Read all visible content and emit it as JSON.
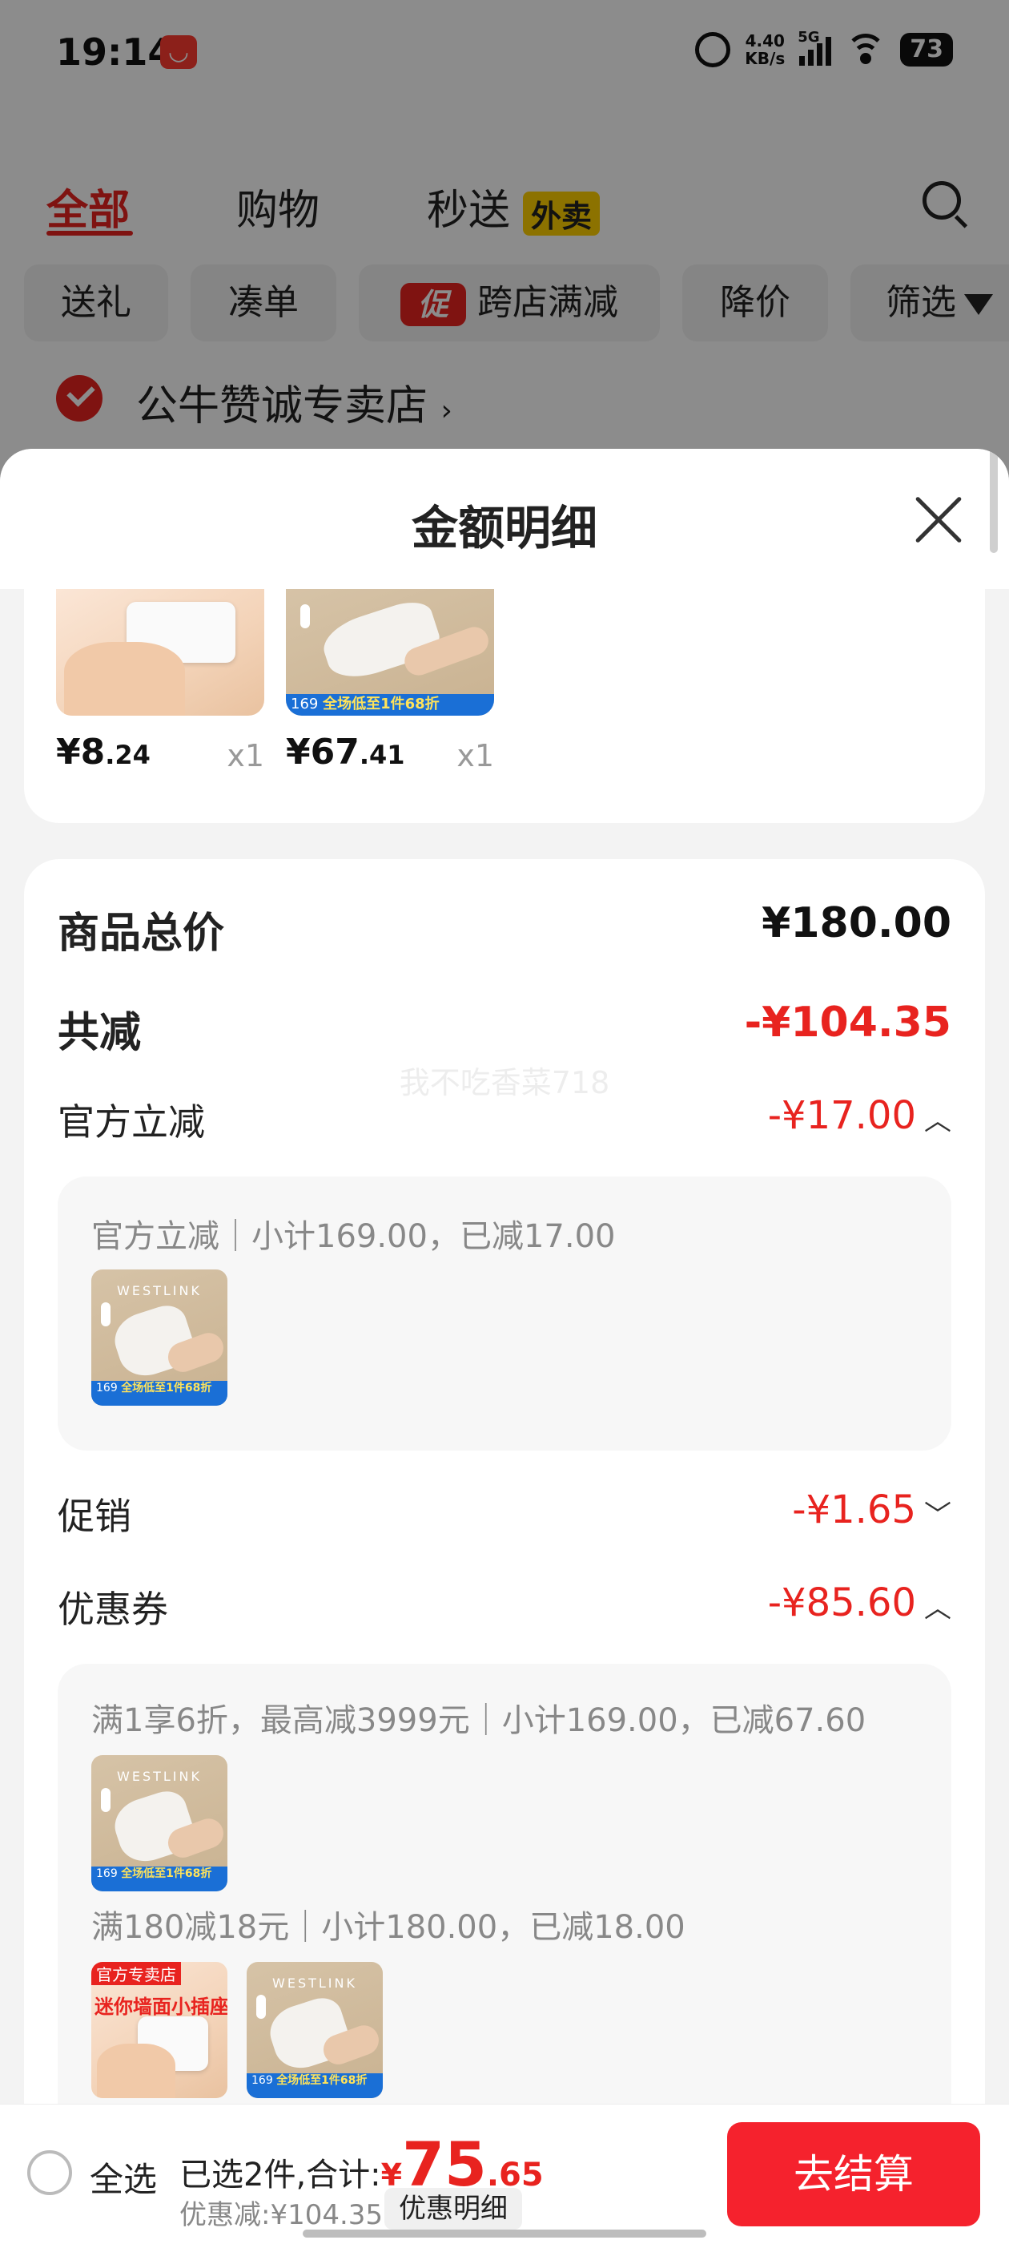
{
  "status_bar": {
    "time": "19:14",
    "app_badge_icon": "tmall-app-icon",
    "net_speed_value": "4.40",
    "net_speed_unit": "KB/s",
    "network_type": "5G",
    "battery": "73"
  },
  "background_page": {
    "tabs": {
      "all": "全部",
      "shopping": "购物",
      "instant": "秒送",
      "takeout_badge": "外卖"
    },
    "filters": {
      "gift": "送礼",
      "bundle": "凑单",
      "promo_tag": "促",
      "cross_store": "跨店满减",
      "price_drop": "降价",
      "filter": "筛选"
    },
    "store_name": "公牛赞诚专卖店"
  },
  "sheet": {
    "title": "金额明细",
    "products": [
      {
        "price_int": "¥8",
        "price_dec": ".24",
        "qty": "x1"
      },
      {
        "price_int": "¥67",
        "price_dec": ".41",
        "qty": "x1"
      }
    ],
    "thumb_text": {
      "brand": "WESTLINK",
      "banner_price": "169",
      "banner_text": "全场低至1件68折",
      "socket_tag": "官方专卖店",
      "socket_slogan": "迷你墙面小插座"
    },
    "summary": {
      "total_label": "商品总价",
      "total_value": "¥180.00",
      "reduce_label": "共减",
      "reduce_value": "-¥104.35",
      "official_label": "官方立减",
      "official_value": "-¥17.00",
      "official_detail": "官方立减｜小计169.00，已减17.00",
      "promo_label": "促销",
      "promo_value": "-¥1.65",
      "coupon_label": "优惠券",
      "coupon_value": "-¥85.60",
      "coupon_detail_1": "满1享6折，最高减3999元｜小计169.00，已减67.60",
      "coupon_detail_2": "满180减18元｜小计180.00，已减18.00",
      "chevron_up": "︿",
      "chevron_down": "﹀"
    },
    "watermark": "我不吃香菜718"
  },
  "checkout": {
    "select_all": "全选",
    "selected_prefix": "已选2件,合计:",
    "yen": "¥",
    "total_int": "75",
    "total_dec": ".65",
    "discount_text": "优惠减:¥104.35",
    "detail_button": "优惠明细",
    "checkout_button": "去结算"
  },
  "colors": {
    "accent_red": "#e8231f",
    "checkout_red": "#f5222d",
    "takeout_yellow": "#ffd000"
  }
}
